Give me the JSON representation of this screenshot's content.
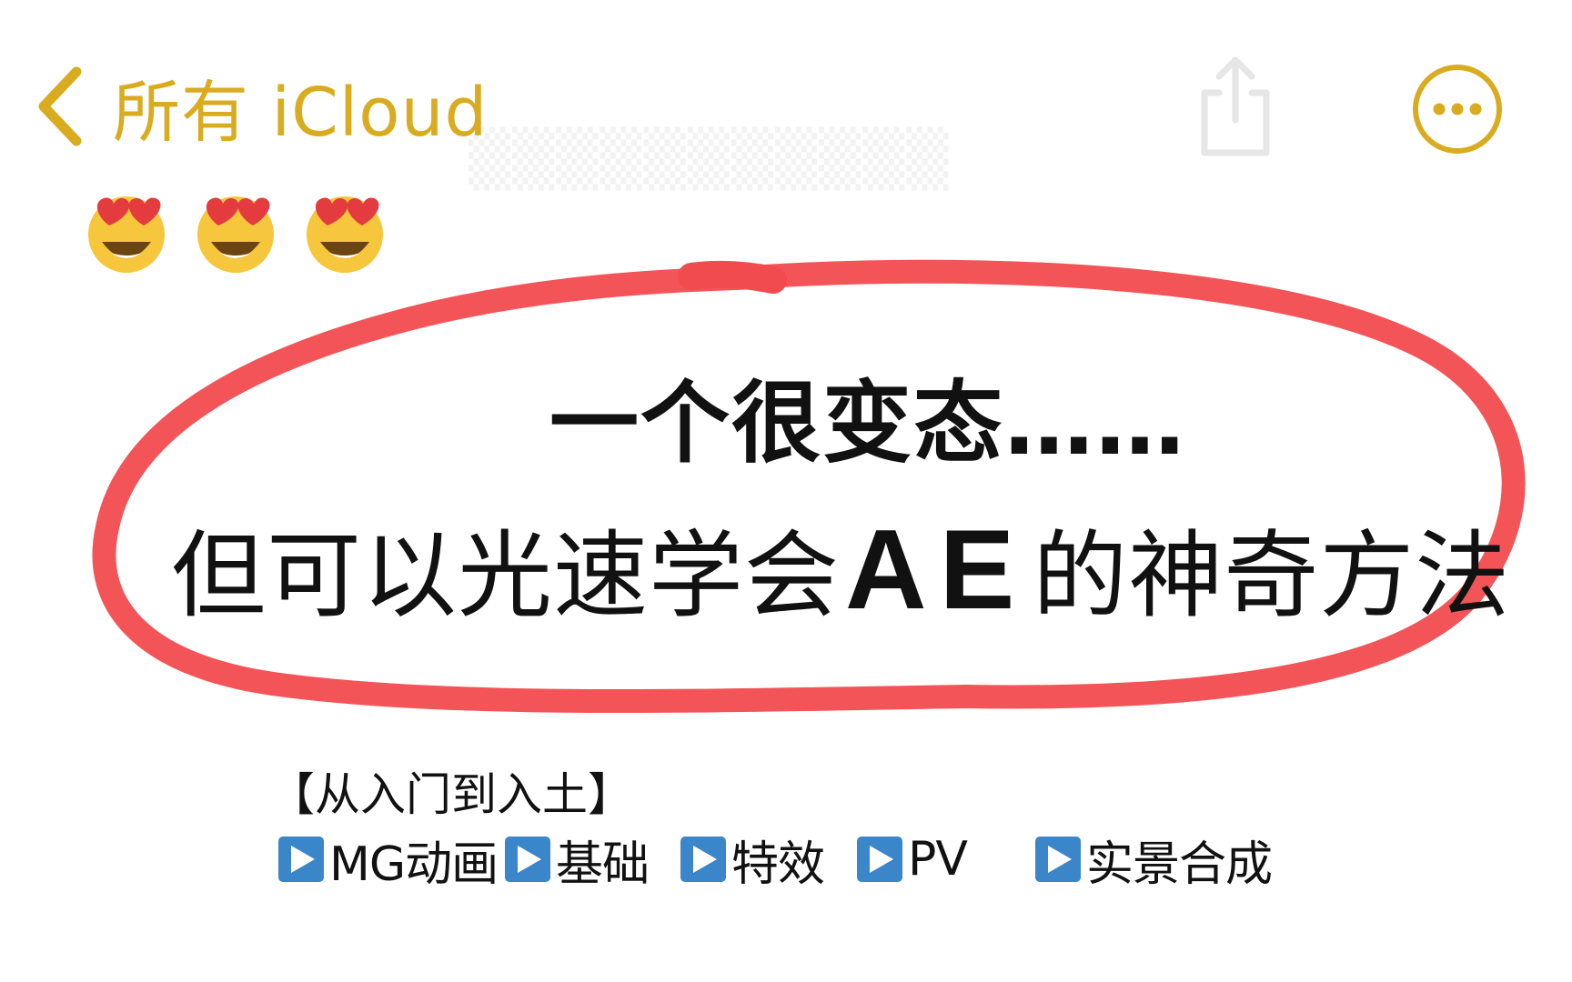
{
  "nav": {
    "back_label": "所有 iCloud",
    "back_icon": "chevron-left-icon",
    "share_icon": "share-icon",
    "more_icon": "ellipsis-circle-icon",
    "accent_color": "#d9ab1f"
  },
  "emojis": [
    {
      "icon": "heart-eyes-emoji-icon"
    },
    {
      "icon": "heart-eyes-emoji-icon"
    },
    {
      "icon": "heart-eyes-emoji-icon"
    }
  ],
  "headline": {
    "line1": "一个很变态……",
    "line2_prefix": "但可以光速学会",
    "line2_ae": "AE",
    "line2_suffix": "的神奇方法"
  },
  "circle_color": "#f24b4f",
  "subtitle": "【从入门到入土】",
  "tags": [
    {
      "label": "MG动画",
      "icon": "play-button-icon"
    },
    {
      "label": "基础",
      "icon": "play-button-icon"
    },
    {
      "label": "特效",
      "icon": "play-button-icon"
    },
    {
      "label": "PV",
      "icon": "play-button-icon"
    },
    {
      "label": "实景合成",
      "icon": "play-button-icon"
    }
  ],
  "tag_icon_color": "#3b86c8"
}
